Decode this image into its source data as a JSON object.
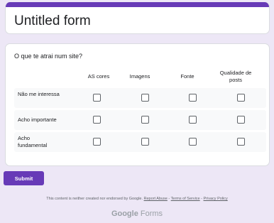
{
  "form": {
    "title": "Untitled form",
    "accent_color": "#673ab7",
    "background_color": "#ede7f6"
  },
  "question": {
    "text": "O que te atrai num site?",
    "columns": [
      "AS cores",
      "Imagens",
      "Fonte",
      "Qualidade de posts"
    ],
    "rows": [
      "Não me interessa",
      "Acho importante",
      "Acho fundamental"
    ]
  },
  "submit": {
    "label": "Submit"
  },
  "footer": {
    "text": "This content is neither created nor endorsed by Google.",
    "report_abuse": "Report Abuse",
    "sep1": " - ",
    "terms": "Terms of Service",
    "sep2": " - ",
    "privacy": "Privacy Policy"
  },
  "brand": {
    "part1": "Google",
    "part2": " Forms"
  }
}
